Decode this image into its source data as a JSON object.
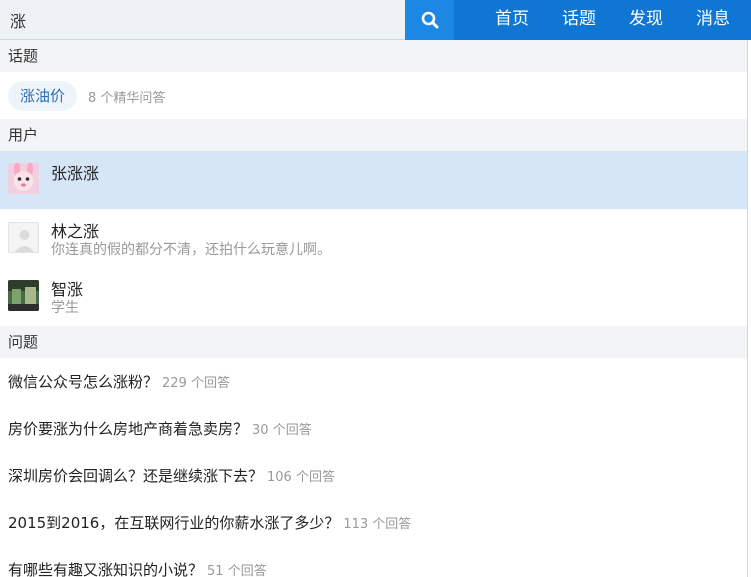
{
  "search": {
    "value": "涨"
  },
  "nav": {
    "home": "首页",
    "topics": "话题",
    "discover": "发现",
    "messages": "消息"
  },
  "sections": {
    "topics": "话题",
    "users": "用户",
    "questions": "问题"
  },
  "topic": {
    "label": "涨油价",
    "meta": "8 个精华问答"
  },
  "users": [
    {
      "name": "张涨涨",
      "desc": ""
    },
    {
      "name": "林之涨",
      "desc": "你连真的假的都分不清，还拍什么玩意儿啊。"
    },
    {
      "name": "智涨",
      "desc": "学生"
    }
  ],
  "questions": [
    {
      "title": "微信公众号怎么涨粉？",
      "answers": "229 个回答"
    },
    {
      "title": "房价要涨为什么房地产商着急卖房？",
      "answers": "30 个回答"
    },
    {
      "title": "深圳房价会回调么？还是继续涨下去？",
      "answers": "106 个回答"
    },
    {
      "title": "2015到2016，在互联网行业的你薪水涨了多少？",
      "answers": "113 个回答"
    },
    {
      "title": "有哪些有趣又涨知识的小说？",
      "answers": "51 个回答"
    }
  ],
  "colors": {
    "brand": "#0f77d3",
    "search_button": "#1d87e4",
    "active_row": "#d6e6f6",
    "section_bg": "#f3f4f6"
  }
}
